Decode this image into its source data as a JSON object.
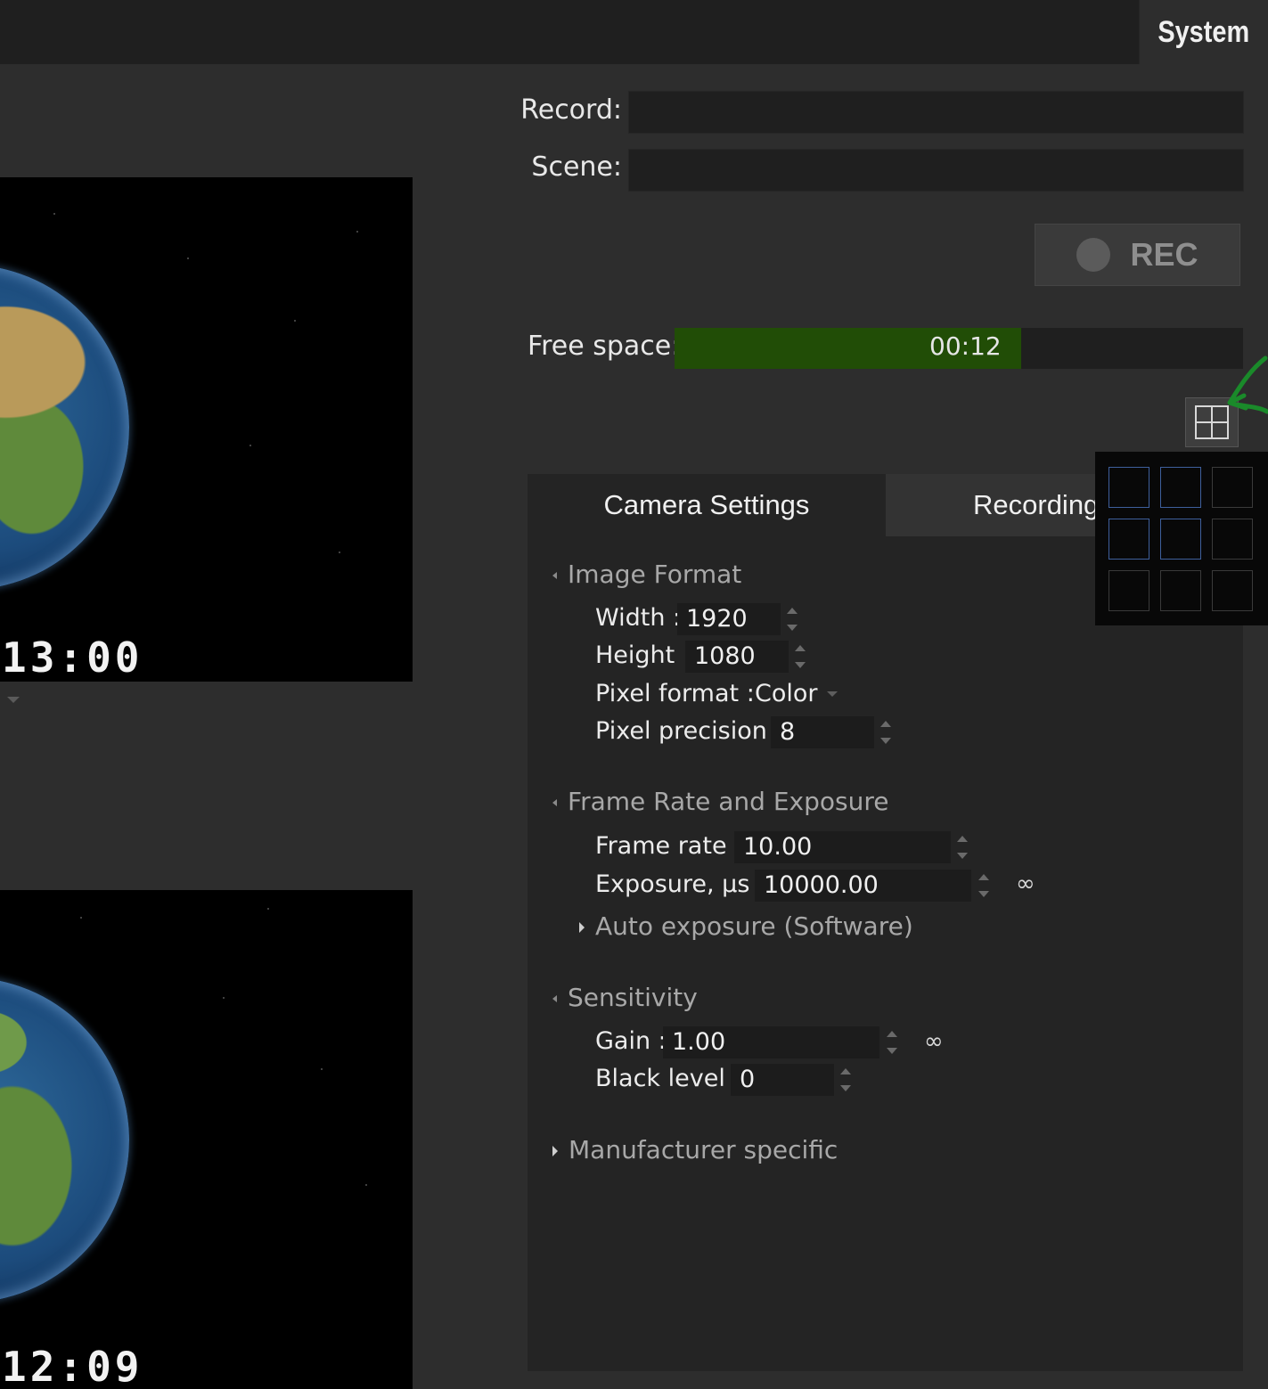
{
  "header": {
    "system_tab": "System"
  },
  "previews": [
    {
      "timecode": "13:00"
    },
    {
      "timecode": "12:09"
    }
  ],
  "record": {
    "label": "Record:",
    "value": ""
  },
  "scene": {
    "label": "Scene:",
    "value": ""
  },
  "rec_button": {
    "label": "REC"
  },
  "free_space": {
    "label": "Free space:",
    "value": "00:12",
    "fill_fraction": 0.61
  },
  "layout_button": {
    "icon": "grid-layout-icon"
  },
  "layout_popup": {
    "rows": 3,
    "cols": 3,
    "selected": [
      [
        0,
        0
      ],
      [
        0,
        1
      ],
      [
        1,
        0
      ],
      [
        1,
        1
      ]
    ]
  },
  "tabs": {
    "camera": "Camera Settings",
    "recording": "Recording"
  },
  "sections": {
    "image_format": {
      "title": "Image Format",
      "width_label": "Width :",
      "width": "1920",
      "height_label": "Height :",
      "height": "1080",
      "pixel_format_label": "Pixel format :",
      "pixel_format": "Color",
      "pixel_precision_label": "Pixel precision :",
      "pixel_precision": "8"
    },
    "frame_rate": {
      "title": "Frame Rate and Exposure",
      "frame_rate_label": "Frame rate :",
      "frame_rate": "10.00",
      "exposure_label": "Exposure, µs :",
      "exposure": "10000.00",
      "auto_exposure": "Auto exposure (Software)"
    },
    "sensitivity": {
      "title": "Sensitivity",
      "gain_label": "Gain :",
      "gain": "1.00",
      "black_level_label": "Black level :",
      "black_level": "0"
    },
    "manufacturer": {
      "title": "Manufacturer specific"
    }
  }
}
